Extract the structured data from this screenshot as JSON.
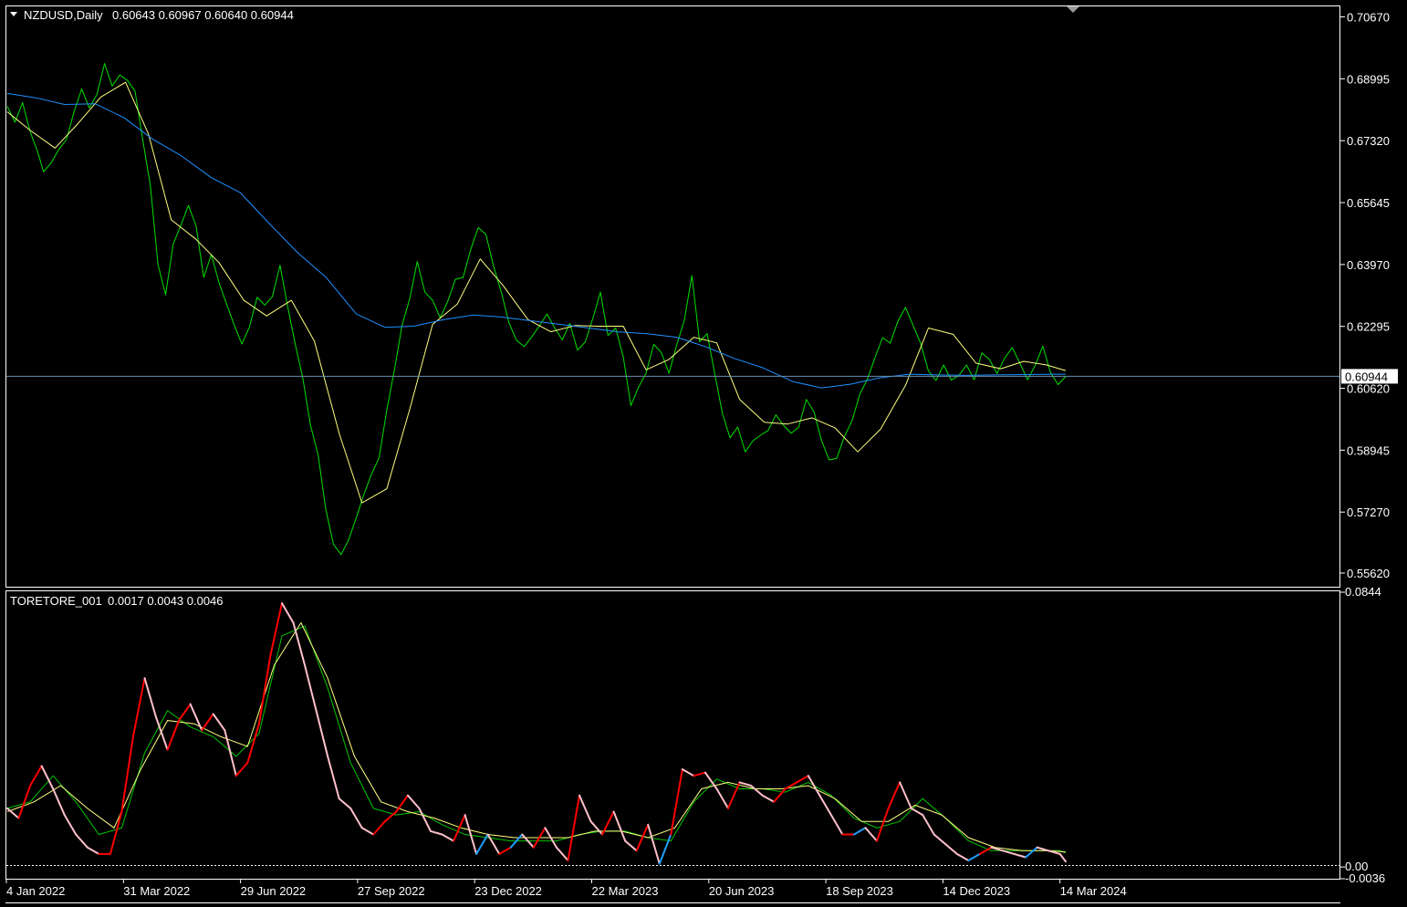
{
  "main_pane": {
    "symbol_label": "NZDUSD,Daily",
    "ohlc_label": "0.60643 0.60967 0.60640 0.60944",
    "current_price_label": "0.60944"
  },
  "indicator_pane": {
    "name_label": "TORETORE_001",
    "values_label": "0.0017 0.0043 0.0046"
  },
  "colors": {
    "background": "#000000",
    "frame": "#ffffff",
    "price": "#00e000",
    "ma_fast": "#ffff80",
    "ma_slow": "#1e90ff",
    "current_price_line": "#6a8fb0",
    "ind_up": "#ff0000",
    "ind_down": "#ffc0cb",
    "ind_alt": "#1e9fff",
    "ind_signal_1": "#00c800",
    "ind_signal_2": "#ffff80"
  },
  "chart_data": [
    {
      "type": "line",
      "title": "NZDUSD,Daily",
      "x_tick_labels": [
        "4 Jan 2022",
        "31 Mar 2022",
        "29 Jun 2022",
        "27 Sep 2022",
        "23 Dec 2022",
        "22 Mar 2023",
        "20 Jun 2023",
        "18 Sep 2023",
        "14 Dec 2023",
        "14 Mar 2024"
      ],
      "y_tick_labels": [
        "0.70670",
        "0.68995",
        "0.67320",
        "0.65645",
        "0.63970",
        "0.62295",
        "0.60620",
        "0.58945",
        "0.57270",
        "0.55620"
      ],
      "ylim": [
        0.5525,
        0.7093
      ],
      "current_value": 0.60944,
      "series": [
        {
          "name": "price",
          "x": [
            0,
            4,
            8,
            12,
            16,
            19,
            23,
            27,
            31,
            35,
            39,
            43,
            47,
            51,
            55,
            59,
            63,
            67,
            71,
            75,
            79,
            83,
            87,
            91,
            95,
            99,
            103,
            107,
            111,
            115,
            119,
            123,
            127,
            131,
            135,
            139,
            143,
            147,
            151,
            155,
            159,
            163,
            167,
            171,
            175,
            179,
            183,
            187,
            191,
            195,
            199,
            203,
            207,
            211,
            215,
            219,
            223,
            227,
            231,
            235,
            239,
            243,
            247,
            251,
            255,
            259,
            263,
            267,
            271,
            275,
            279,
            283,
            287,
            291,
            295,
            299,
            303,
            307,
            311,
            315,
            319,
            323,
            327,
            331,
            335,
            339,
            343,
            347,
            351,
            355,
            359,
            363,
            367,
            371,
            375,
            379,
            383,
            387,
            391,
            395,
            399,
            403,
            407,
            411,
            415,
            419,
            423,
            427,
            431,
            435,
            439,
            443,
            447,
            451,
            455,
            459,
            463,
            467,
            471,
            475,
            479,
            483,
            487,
            491,
            495,
            499,
            503,
            507,
            511,
            515,
            519,
            523,
            527,
            531,
            535,
            539,
            543,
            547,
            551,
            555
          ],
          "y": [
            0.6825,
            0.6782,
            0.6835,
            0.6756,
            0.6701,
            0.6648,
            0.6672,
            0.6708,
            0.6735,
            0.681,
            0.6872,
            0.6821,
            0.6857,
            0.6941,
            0.688,
            0.691,
            0.6895,
            0.6866,
            0.6735,
            0.661,
            0.6398,
            0.6315,
            0.6452,
            0.6503,
            0.6557,
            0.6501,
            0.6362,
            0.6424,
            0.6348,
            0.629,
            0.6233,
            0.6182,
            0.6228,
            0.6308,
            0.6287,
            0.631,
            0.6395,
            0.6284,
            0.6181,
            0.6089,
            0.5962,
            0.5881,
            0.5735,
            0.564,
            0.5612,
            0.5652,
            0.5712,
            0.5775,
            0.583,
            0.5874,
            0.6003,
            0.6112,
            0.6232,
            0.6304,
            0.6405,
            0.6322,
            0.63,
            0.6253,
            0.6298,
            0.6357,
            0.6362,
            0.6438,
            0.6497,
            0.6478,
            0.6393,
            0.6323,
            0.624,
            0.6192,
            0.6175,
            0.6201,
            0.6231,
            0.6263,
            0.6226,
            0.6193,
            0.6238,
            0.6165,
            0.6187,
            0.625,
            0.6322,
            0.6205,
            0.6225,
            0.6147,
            0.6015,
            0.6065,
            0.6103,
            0.6181,
            0.6158,
            0.6103,
            0.6179,
            0.6245,
            0.6367,
            0.6188,
            0.621,
            0.6101,
            0.5993,
            0.5928,
            0.5957,
            0.589,
            0.592,
            0.5935,
            0.5948,
            0.599,
            0.5962,
            0.594,
            0.5957,
            0.6032,
            0.5998,
            0.592,
            0.5868,
            0.5873,
            0.5932,
            0.5975,
            0.6045,
            0.6087,
            0.6145,
            0.6199,
            0.6184,
            0.6243,
            0.6281,
            0.6232,
            0.6183,
            0.6109,
            0.6083,
            0.6125,
            0.6084,
            0.6097,
            0.6125,
            0.6085,
            0.6158,
            0.614,
            0.6102,
            0.6144,
            0.6172,
            0.613,
            0.6085,
            0.6124,
            0.6176,
            0.6105,
            0.6072,
            0.6094
          ]
        },
        {
          "name": "ma_fast",
          "x": [
            0,
            12,
            25,
            37,
            49,
            62,
            74,
            86,
            99,
            111,
            124,
            136,
            149,
            161,
            174,
            186,
            199,
            211,
            223,
            236,
            248,
            260,
            273,
            285,
            298,
            310,
            323,
            335,
            347,
            360,
            372,
            384,
            397,
            409,
            422,
            434,
            446,
            458,
            471,
            483,
            496,
            508,
            521,
            533,
            545,
            555
          ],
          "y": [
            0.681,
            0.676,
            0.6712,
            0.6778,
            0.685,
            0.689,
            0.675,
            0.6518,
            0.6465,
            0.6402,
            0.63,
            0.6258,
            0.63,
            0.619,
            0.594,
            0.5752,
            0.579,
            0.6005,
            0.6235,
            0.629,
            0.6412,
            0.634,
            0.6248,
            0.6215,
            0.6232,
            0.623,
            0.623,
            0.6112,
            0.614,
            0.62,
            0.6185,
            0.6032,
            0.597,
            0.5965,
            0.5982,
            0.5955,
            0.589,
            0.5952,
            0.607,
            0.6225,
            0.6208,
            0.613,
            0.6115,
            0.6135,
            0.6125,
            0.611
          ]
        },
        {
          "name": "ma_slow",
          "x": [
            0,
            15,
            30,
            46,
            61,
            76,
            91,
            107,
            122,
            137,
            152,
            167,
            183,
            198,
            213,
            229,
            244,
            259,
            274,
            290,
            305,
            320,
            335,
            351,
            366,
            381,
            396,
            412,
            427,
            442,
            457,
            473,
            488,
            503,
            518,
            534,
            549,
            555
          ],
          "y": [
            0.686,
            0.6848,
            0.683,
            0.6832,
            0.6795,
            0.6737,
            0.6692,
            0.6632,
            0.6592,
            0.651,
            0.643,
            0.6363,
            0.6263,
            0.6227,
            0.623,
            0.6248,
            0.626,
            0.6255,
            0.6245,
            0.6235,
            0.6225,
            0.6215,
            0.621,
            0.62,
            0.6175,
            0.6143,
            0.6118,
            0.608,
            0.6063,
            0.6073,
            0.609,
            0.61,
            0.6098,
            0.6097,
            0.6098,
            0.6099,
            0.61,
            0.61
          ]
        }
      ]
    },
    {
      "type": "line",
      "title": "TORETORE_001",
      "y_tick_labels": [
        "0.0844",
        "0.00",
        "-0.0036"
      ],
      "ylim": [
        -0.0036,
        0.0844
      ],
      "series": [
        {
          "name": "main",
          "x": [
            0,
            6,
            12,
            18,
            24,
            30,
            36,
            42,
            48,
            54,
            60,
            66,
            72,
            78,
            84,
            90,
            96,
            102,
            108,
            114,
            120,
            126,
            132,
            138,
            144,
            150,
            156,
            162,
            168,
            174,
            180,
            186,
            192,
            198,
            204,
            210,
            216,
            222,
            228,
            234,
            240,
            246,
            252,
            258,
            264,
            270,
            276,
            282,
            288,
            294,
            300,
            306,
            312,
            318,
            324,
            330,
            336,
            342,
            348,
            354,
            360,
            366,
            372,
            378,
            384,
            390,
            396,
            402,
            408,
            414,
            420,
            426,
            432,
            438,
            444,
            450,
            456,
            462,
            468,
            474,
            480,
            486,
            492,
            498,
            504,
            510,
            516,
            522,
            528,
            534,
            540,
            546,
            552,
            555
          ],
          "y": [
            0.018,
            0.015,
            0.025,
            0.031,
            0.024,
            0.016,
            0.01,
            0.006,
            0.004,
            0.004,
            0.017,
            0.04,
            0.058,
            0.046,
            0.036,
            0.045,
            0.05,
            0.042,
            0.047,
            0.042,
            0.028,
            0.032,
            0.044,
            0.065,
            0.081,
            0.075,
            0.062,
            0.048,
            0.034,
            0.021,
            0.018,
            0.012,
            0.01,
            0.014,
            0.017,
            0.022,
            0.018,
            0.011,
            0.01,
            0.008,
            0.016,
            0.004,
            0.01,
            0.004,
            0.006,
            0.01,
            0.006,
            0.012,
            0.006,
            0.002,
            0.022,
            0.014,
            0.01,
            0.017,
            0.008,
            0.005,
            0.013,
            0.001,
            0.01,
            0.03,
            0.028,
            0.029,
            0.024,
            0.018,
            0.026,
            0.025,
            0.022,
            0.02,
            0.024,
            0.026,
            0.028,
            0.022,
            0.016,
            0.01,
            0.01,
            0.012,
            0.008,
            0.018,
            0.026,
            0.018,
            0.016,
            0.01,
            0.007,
            0.004,
            0.002,
            0.004,
            0.006,
            0.005,
            0.004,
            0.003,
            0.006,
            0.005,
            0.004,
            0.0017
          ]
        },
        {
          "name": "signal_1",
          "x": [
            0,
            12,
            24,
            36,
            48,
            60,
            72,
            84,
            96,
            108,
            120,
            132,
            144,
            156,
            168,
            180,
            192,
            204,
            216,
            228,
            240,
            252,
            264,
            276,
            288,
            300,
            312,
            324,
            336,
            348,
            360,
            372,
            384,
            396,
            408,
            420,
            432,
            444,
            456,
            468,
            480,
            492,
            504,
            516,
            528,
            540,
            552,
            555
          ],
          "y": [
            0.018,
            0.02,
            0.028,
            0.02,
            0.01,
            0.012,
            0.035,
            0.048,
            0.043,
            0.04,
            0.034,
            0.041,
            0.071,
            0.074,
            0.055,
            0.032,
            0.018,
            0.016,
            0.017,
            0.013,
            0.01,
            0.009,
            0.008,
            0.008,
            0.008,
            0.01,
            0.011,
            0.011,
            0.009,
            0.008,
            0.02,
            0.027,
            0.024,
            0.024,
            0.023,
            0.026,
            0.022,
            0.015,
            0.012,
            0.014,
            0.021,
            0.015,
            0.008,
            0.005,
            0.005,
            0.005,
            0.005,
            0.0043
          ]
        },
        {
          "name": "signal_2",
          "x": [
            0,
            14,
            28,
            42,
            56,
            70,
            84,
            98,
            112,
            126,
            140,
            154,
            168,
            182,
            196,
            210,
            224,
            238,
            252,
            266,
            280,
            294,
            308,
            322,
            336,
            350,
            364,
            378,
            392,
            406,
            420,
            434,
            448,
            462,
            476,
            490,
            504,
            518,
            532,
            546,
            555
          ],
          "y": [
            0.017,
            0.02,
            0.025,
            0.018,
            0.012,
            0.03,
            0.045,
            0.044,
            0.04,
            0.037,
            0.062,
            0.075,
            0.058,
            0.034,
            0.02,
            0.017,
            0.015,
            0.012,
            0.01,
            0.009,
            0.009,
            0.009,
            0.011,
            0.011,
            0.009,
            0.012,
            0.024,
            0.026,
            0.024,
            0.024,
            0.025,
            0.021,
            0.014,
            0.014,
            0.019,
            0.016,
            0.009,
            0.006,
            0.005,
            0.005,
            0.0046
          ]
        }
      ]
    }
  ]
}
